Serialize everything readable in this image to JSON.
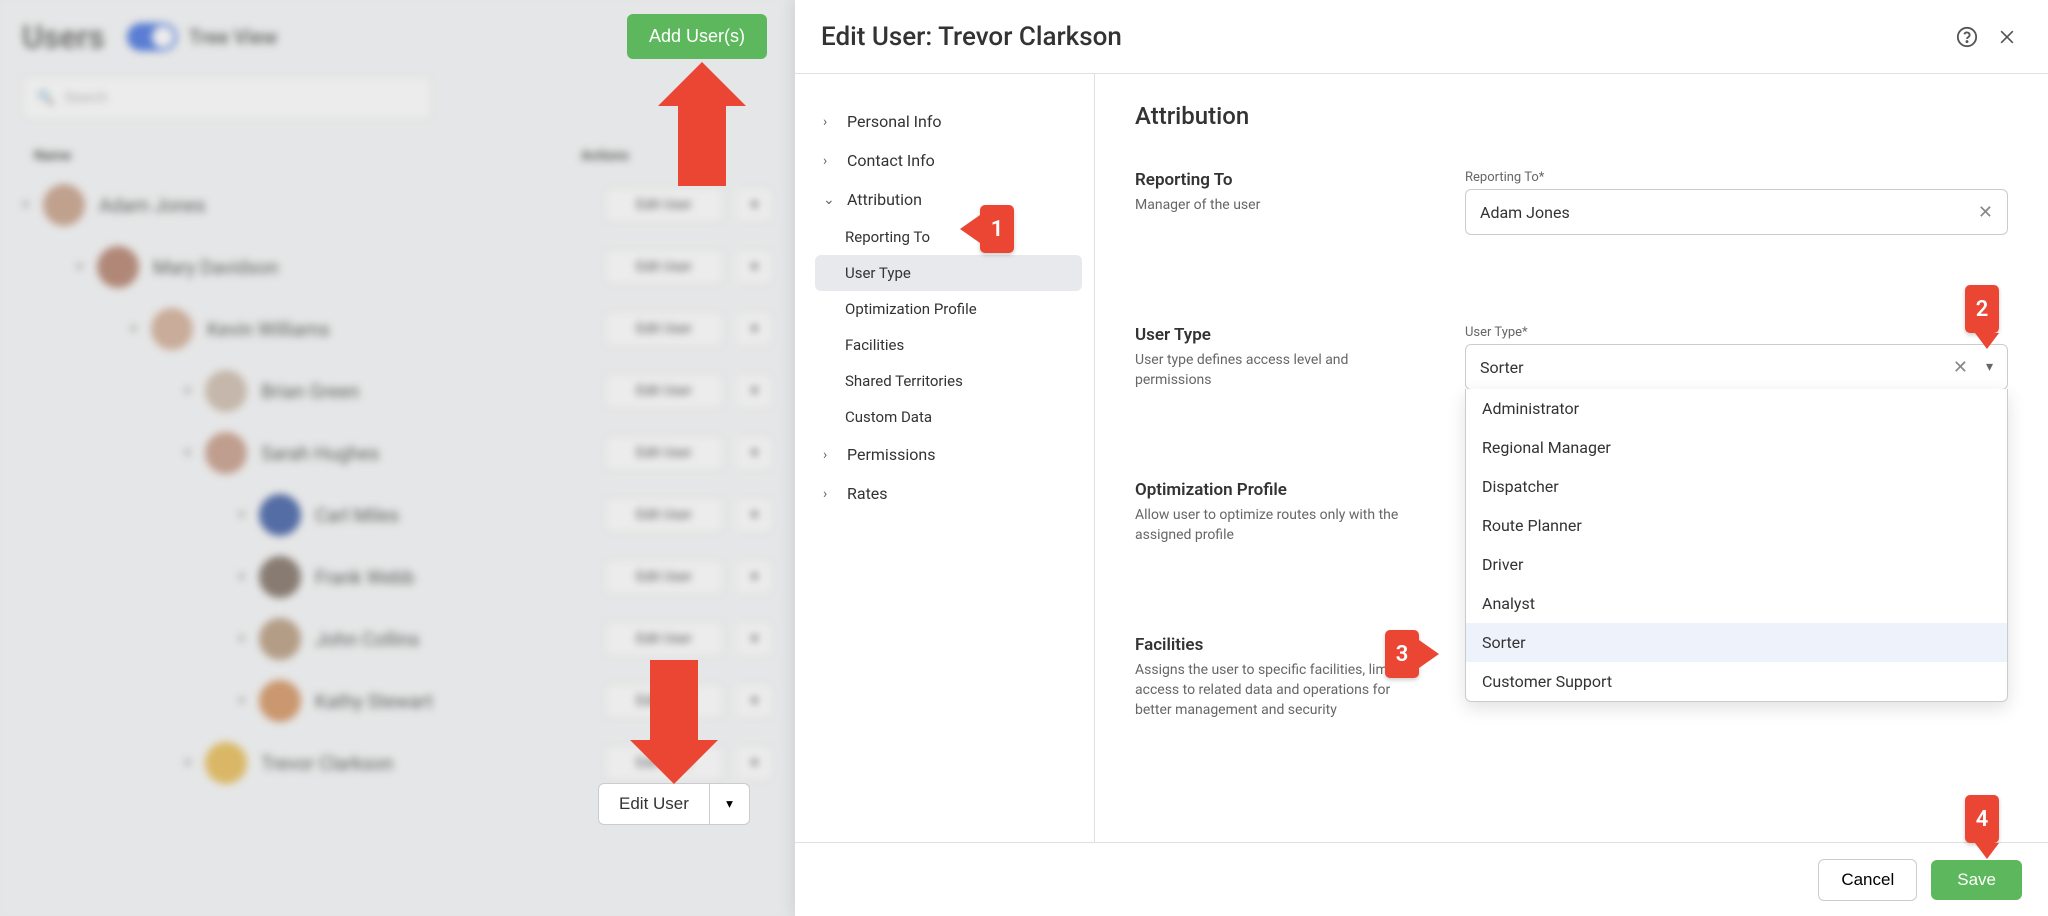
{
  "listHeader": {
    "title": "Users",
    "treeViewLabel": "Tree View",
    "searchPlaceholder": "Search",
    "colName": "Name",
    "colActions": "Actions"
  },
  "addUsersLabel": "Add User(s)",
  "editUserBtn": "Edit User",
  "users": [
    {
      "name": "Adam Jones",
      "indent": 0,
      "hue": "#c49b82",
      "action": "Edit User"
    },
    {
      "name": "Mary Davidson",
      "indent": 1,
      "hue": "#b07a65",
      "action": "Edit User"
    },
    {
      "name": "Kevin Williams",
      "indent": 2,
      "hue": "#d0aa90",
      "action": "Edit User"
    },
    {
      "name": "Brian Green",
      "indent": 3,
      "hue": "#cbb9a8",
      "action": "Edit User"
    },
    {
      "name": "Sarah Hughes",
      "indent": 3,
      "hue": "#c49782",
      "action": "Edit User"
    },
    {
      "name": "Carl Miles",
      "indent": 4,
      "hue": "#3556a0",
      "action": "Edit User"
    },
    {
      "name": "Frank Webb",
      "indent": 4,
      "hue": "#7a6a5d",
      "action": "Edit User"
    },
    {
      "name": "John Collins",
      "indent": 4,
      "hue": "#b49679",
      "action": "Edit User"
    },
    {
      "name": "Kathy Stewart",
      "indent": 4,
      "hue": "#d28e58",
      "action": "Edit User"
    },
    {
      "name": "Trevor Clarkson",
      "indent": 3,
      "hue": "#e6b94c",
      "action": "Edit User"
    }
  ],
  "panel": {
    "titlePrefix": "Edit User: ",
    "userName": "Trevor Clarkson",
    "sectionTitle": "Attribution",
    "toc": {
      "groups": [
        {
          "label": "Personal Info",
          "open": false
        },
        {
          "label": "Contact Info",
          "open": false
        },
        {
          "label": "Attribution",
          "open": true,
          "items": [
            "Reporting To",
            "User Type",
            "Optimization Profile",
            "Facilities",
            "Shared Territories",
            "Custom Data"
          ],
          "activeIndex": 1
        },
        {
          "label": "Permissions",
          "open": false
        },
        {
          "label": "Rates",
          "open": false
        }
      ]
    },
    "fields": {
      "reportingTo": {
        "heading": "Reporting To",
        "desc": "Manager of the user",
        "label": "Reporting To*",
        "value": "Adam Jones"
      },
      "userType": {
        "heading": "User Type",
        "desc": "User type defines access level and permissions",
        "label": "User Type*",
        "value": "Sorter",
        "options": [
          "Administrator",
          "Regional Manager",
          "Dispatcher",
          "Route Planner",
          "Driver",
          "Analyst",
          "Sorter",
          "Customer Support"
        ],
        "selectedIndex": 6
      },
      "optProfile": {
        "heading": "Optimization Profile",
        "desc": "Allow user to optimize routes only with the assigned profile"
      },
      "facilities": {
        "heading": "Facilities",
        "desc": "Assigns the user to specific facilities, limiting access to related data and operations for better management and security"
      }
    },
    "footer": {
      "cancel": "Cancel",
      "save": "Save"
    }
  },
  "annotations": {
    "b1": "1",
    "b2": "2",
    "b3": "3",
    "b4": "4"
  }
}
